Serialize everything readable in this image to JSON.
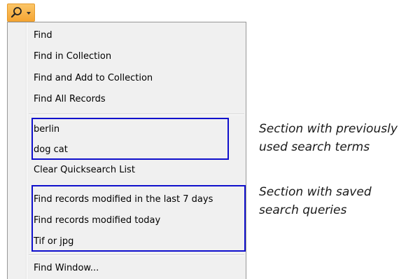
{
  "toolbar": {
    "search_button_icon": "magnifier-icon",
    "dropdown_icon": "caret-down-icon",
    "accent_color": "#f5a533"
  },
  "menu": {
    "find_items": [
      {
        "label": "Find"
      },
      {
        "label": "Find in Collection"
      },
      {
        "label": "Find and Add to Collection"
      },
      {
        "label": "Find All Records"
      }
    ],
    "recent_terms": [
      {
        "label": "berlin"
      },
      {
        "label": "dog cat"
      }
    ],
    "clear_label": "Clear Quicksearch List",
    "saved_queries": [
      {
        "label": "Find records modified in the last 7 days"
      },
      {
        "label": "Find records modified today"
      },
      {
        "label": "Tif or jpg"
      }
    ],
    "find_window_label": "Find Window..."
  },
  "annotations": {
    "recent_line1": "Section with previously",
    "recent_line2": "used search terms",
    "saved_line1": "Section with saved",
    "saved_line2": "search queries",
    "highlight_color": "#1010cc"
  }
}
